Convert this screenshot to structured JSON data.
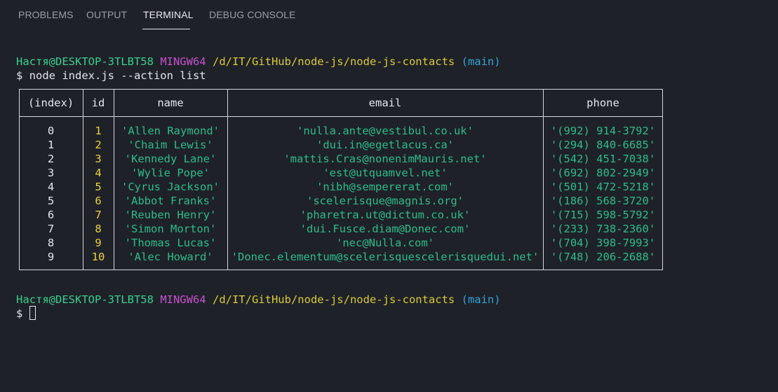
{
  "tabs": [
    {
      "label": "PROBLEMS"
    },
    {
      "label": "OUTPUT"
    },
    {
      "label": "TERMINAL",
      "active": true
    },
    {
      "label": "DEBUG CONSOLE"
    }
  ],
  "prompt1": {
    "user": "Настя@DESKTOP-3TLBT58",
    "system": "MINGW64",
    "path": "/d/IT/GitHub/node-js/node-js-contacts",
    "branch": "(main)"
  },
  "command": "$ node index.js --action list",
  "table": {
    "headers": [
      "(index)",
      "id",
      "name",
      "email",
      "phone"
    ],
    "rows": [
      {
        "index": "0",
        "id": "1",
        "name": "'Allen Raymond'",
        "email": "'nulla.ante@vestibul.co.uk'",
        "phone": "'(992) 914-3792'"
      },
      {
        "index": "1",
        "id": "2",
        "name": "'Chaim Lewis'",
        "email": "'dui.in@egetlacus.ca'",
        "phone": "'(294) 840-6685'"
      },
      {
        "index": "2",
        "id": "3",
        "name": "'Kennedy Lane'",
        "email": "'mattis.Cras@nonenimMauris.net'",
        "phone": "'(542) 451-7038'"
      },
      {
        "index": "3",
        "id": "4",
        "name": "'Wylie Pope'",
        "email": "'est@utquamvel.net'",
        "phone": "'(692) 802-2949'"
      },
      {
        "index": "4",
        "id": "5",
        "name": "'Cyrus Jackson'",
        "email": "'nibh@sempererat.com'",
        "phone": "'(501) 472-5218'"
      },
      {
        "index": "5",
        "id": "6",
        "name": "'Abbot Franks'",
        "email": "'scelerisque@magnis.org'",
        "phone": "'(186) 568-3720'"
      },
      {
        "index": "6",
        "id": "7",
        "name": "'Reuben Henry'",
        "email": "'pharetra.ut@dictum.co.uk'",
        "phone": "'(715) 598-5792'"
      },
      {
        "index": "7",
        "id": "8",
        "name": "'Simon Morton'",
        "email": "'dui.Fusce.diam@Donec.com'",
        "phone": "'(233) 738-2360'"
      },
      {
        "index": "8",
        "id": "9",
        "name": "'Thomas Lucas'",
        "email": "'nec@Nulla.com'",
        "phone": "'(704) 398-7993'"
      },
      {
        "index": "9",
        "id": "10",
        "name": "'Alec Howard'",
        "email": "'Donec.elementum@scelerisquescelerisquedui.net'",
        "phone": "'(748) 206-2688'"
      }
    ]
  },
  "prompt2": {
    "user": "Настя@DESKTOP-3TLBT58",
    "system": "MINGW64",
    "path": "/d/IT/GitHub/node-js/node-js-contacts",
    "branch": "(main)"
  },
  "input_prompt": "$",
  "colors": {
    "background": "#1f2128",
    "user": "#39d08f",
    "system": "#c552cf",
    "path": "#d8cb3b",
    "branch": "#33a5d8",
    "string": "#2dbd8a",
    "number": "#ecd33b"
  }
}
